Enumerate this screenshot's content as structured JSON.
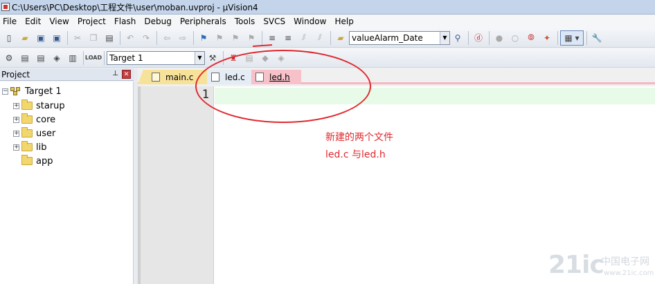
{
  "window": {
    "title": "C:\\Users\\PC\\Desktop\\工程文件\\user\\moban.uvproj - µVision4"
  },
  "menu": [
    "File",
    "Edit",
    "View",
    "Project",
    "Flash",
    "Debug",
    "Peripherals",
    "Tools",
    "SVCS",
    "Window",
    "Help"
  ],
  "toolbar1": {
    "icons": [
      "new-file-icon",
      "open-icon",
      "save-icon",
      "save-all-icon",
      "cut-icon",
      "copy-icon",
      "paste-icon",
      "undo-icon",
      "redo-icon",
      "nav-back-icon",
      "nav-forward-icon",
      "bookmark-icon",
      "prev-bookmark-icon",
      "next-bookmark-icon",
      "clear-bookmarks-icon",
      "indent-icon",
      "unindent-icon",
      "comment-icon",
      "uncomment-icon",
      "find-in-files-icon",
      "find-icon",
      "debug-session-icon",
      "breakpoint-icon",
      "disable-breakpoint-icon",
      "kill-breakpoints-icon",
      "window-layout-icon",
      "configure-icon"
    ],
    "find_combo_value": "valueAlarm_Date"
  },
  "toolbar2": {
    "icons": [
      "translate-icon",
      "build-icon",
      "rebuild-icon",
      "batch-build-icon",
      "stop-build-icon",
      "download-icon",
      "options-for-target-icon",
      "manage-components-icon",
      "select-packs-icon",
      "run-icon",
      "step-icon"
    ],
    "target_select": "Target 1"
  },
  "project_panel": {
    "header": "Project",
    "tree": [
      {
        "label": "Target 1",
        "type": "target",
        "expander": "−"
      },
      {
        "label": "starup",
        "type": "folder",
        "expander": "+"
      },
      {
        "label": "core",
        "type": "folder",
        "expander": "+"
      },
      {
        "label": "user",
        "type": "folder",
        "expander": "+"
      },
      {
        "label": "lib",
        "type": "folder",
        "expander": "+"
      },
      {
        "label": "app",
        "type": "folder",
        "expander": ""
      }
    ]
  },
  "tabs": [
    {
      "label": "main.c",
      "color": "#f7e29a"
    },
    {
      "label": "led.c",
      "color": "#e4ecf5"
    },
    {
      "label": "led.h",
      "color": "#f6c1c8",
      "active": true
    }
  ],
  "editor": {
    "line_number": "1",
    "current_line_color": "#e8fbe8"
  },
  "annotation": {
    "line1": "新建的两个文件",
    "line2": "led.c 与led.h",
    "color": "#e0272d"
  },
  "watermark": {
    "logo": "21ic",
    "sub": "中国电子网",
    "url": "www.21ic.com"
  }
}
